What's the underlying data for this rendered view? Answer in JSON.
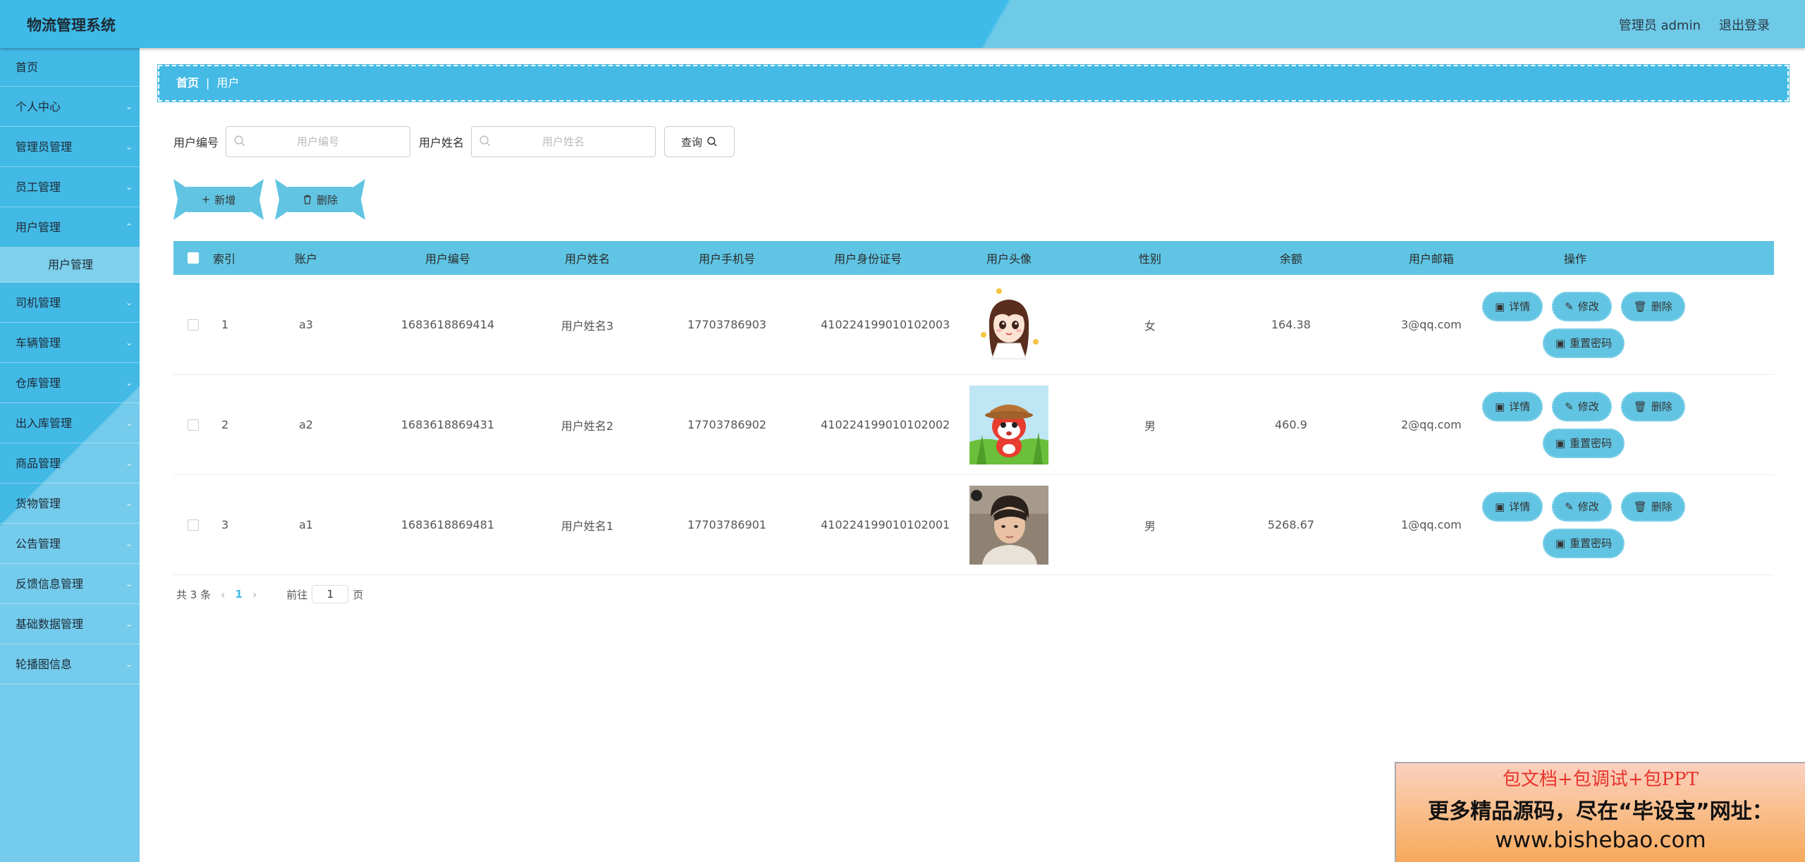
{
  "header": {
    "title": "物流管理系统",
    "admin": "管理员 admin",
    "logout": "退出登录"
  },
  "sidebar": {
    "items": [
      {
        "label": "首页",
        "chevron": false
      },
      {
        "label": "个人中心",
        "chevron": true
      },
      {
        "label": "管理员管理",
        "chevron": true
      },
      {
        "label": "员工管理",
        "chevron": true
      },
      {
        "label": "用户管理",
        "chevron": true
      },
      {
        "label": "司机管理",
        "chevron": true
      },
      {
        "label": "车辆管理",
        "chevron": true
      },
      {
        "label": "仓库管理",
        "chevron": true
      },
      {
        "label": "出入库管理",
        "chevron": true
      },
      {
        "label": "商品管理",
        "chevron": true
      },
      {
        "label": "货物管理",
        "chevron": true
      },
      {
        "label": "公告管理",
        "chevron": true
      },
      {
        "label": "反馈信息管理",
        "chevron": true
      },
      {
        "label": "基础数据管理",
        "chevron": true
      },
      {
        "label": "轮播图信息",
        "chevron": true
      }
    ],
    "sub_item": "用户管理"
  },
  "breadcrumb": {
    "home": "首页",
    "sep": "|",
    "current": "用户"
  },
  "search": {
    "label1": "用户编号",
    "placeholder1": "用户编号",
    "label2": "用户姓名",
    "placeholder2": "用户姓名",
    "query": "查询"
  },
  "actions": {
    "add": "新增",
    "delete": "删除"
  },
  "table": {
    "headers": [
      "索引",
      "账户",
      "用户编号",
      "用户姓名",
      "用户手机号",
      "用户身份证号",
      "用户头像",
      "性别",
      "余额",
      "用户邮箱",
      "操作"
    ],
    "rows": [
      {
        "idx": "1",
        "account": "a3",
        "no": "1683618869414",
        "name": "用户姓名3",
        "phone": "17703786903",
        "id": "410224199010102003",
        "avatar": "cartoon-girl",
        "sex": "女",
        "balance": "164.38",
        "email": "3@qq.com"
      },
      {
        "idx": "2",
        "account": "a2",
        "no": "1683618869431",
        "name": "用户姓名2",
        "phone": "17703786902",
        "id": "410224199010102002",
        "avatar": "cartoon-fox",
        "sex": "男",
        "balance": "460.9",
        "email": "2@qq.com"
      },
      {
        "idx": "3",
        "account": "a1",
        "no": "1683618869481",
        "name": "用户姓名1",
        "phone": "17703786901",
        "id": "410224199010102001",
        "avatar": "photo-boy",
        "sex": "男",
        "balance": "5268.67",
        "email": "1@qq.com"
      }
    ],
    "ops": {
      "detail": "详情",
      "edit": "修改",
      "delete": "删除",
      "reset": "重置密码"
    }
  },
  "pager": {
    "total": "共 3 条",
    "page": "1",
    "goto": "前往",
    "jump_value": "1",
    "unit": "页"
  },
  "ad": {
    "line1": "包文档+包调试+包PPT",
    "line2": "更多精品源码，尽在“毕设宝”网址：",
    "line3": "www.bishebao.com"
  }
}
